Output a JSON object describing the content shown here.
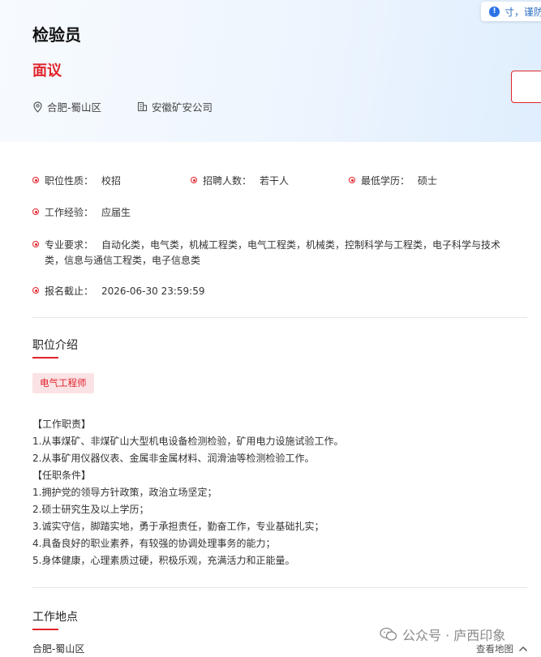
{
  "header": {
    "title": "检验员",
    "salary": "面议",
    "location": "合肥-蜀山区",
    "company": "安徽矿安公司",
    "notice": "寸，谨防上"
  },
  "details": {
    "nature_label": "职位性质：",
    "nature_value": "校招",
    "count_label": "招聘人数：",
    "count_value": "若干人",
    "edu_label": "最低学历：",
    "edu_value": "硕士",
    "exp_label": "工作经验：",
    "exp_value": "应届生",
    "major_label": "专业要求：",
    "major_value": "自动化类，电气类，机械工程类，电气工程类，机械类，控制科学与工程类，电子科学与技术类，信息与通信工程类，电子信息类",
    "deadline_label": "报名截止：",
    "deadline_value": "2026-06-30 23:59:59"
  },
  "intro": {
    "title": "职位介绍",
    "tag": "电气工程师",
    "lines": [
      "【工作职责】",
      "1.从事煤矿、非煤矿山大型机电设备检测检验，矿用电力设施试验工作。",
      "2.从事矿用仪器仪表、金属非金属材料、润滑油等检测检验工作。",
      "【任职条件】",
      "1.拥护党的领导方针政策，政治立场坚定；",
      "2.硕士研究生及以上学历；",
      "3.诚实守信，脚踏实地，勇于承担责任，勤奋工作，专业基础扎实；",
      "4.具备良好的职业素养，有较强的协调处理事务的能力；",
      "5.身体健康，心理素质过硬，积极乐观，充满活力和正能量。"
    ]
  },
  "work_location": {
    "title": "工作地点",
    "address": "合肥-蜀山区",
    "map_link": "查看地图"
  },
  "watermark": "公众号 · 庐西印象",
  "colors": {
    "accent": "#e0242b",
    "tag_bg": "#fbe3e5",
    "header_bg": "#eef5fe",
    "info_blue": "#2b72e6"
  }
}
